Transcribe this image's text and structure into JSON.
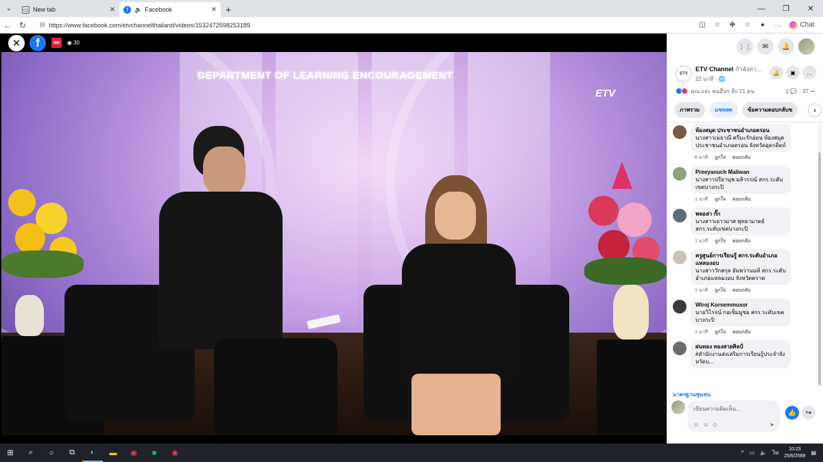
{
  "browser": {
    "tabs": [
      {
        "label": "New tab",
        "icon": "new-tab-icon"
      },
      {
        "label": "Facebook",
        "icon": "facebook-icon",
        "audio": true
      }
    ],
    "url": "https://www.facebook.com/etvchannelthailand/videos/1532472598253189",
    "chat_label": "Chat"
  },
  "video": {
    "live_badge": "สด",
    "viewer_count": "30",
    "banner_text": "DEPARTMENT OF LEARNING ENCOURAGEMENT",
    "channel_logo": "ETV"
  },
  "page": {
    "name": "ETV Channel",
    "status_suffix": "กำลังถ่า...",
    "time": "22 นาที",
    "reactions_text": "คุณ และ คนอื่นๆ อีก 21 คน",
    "comment_count": "1",
    "share_count": "37"
  },
  "comment_tabs": [
    "ภาพรวม",
    "แชทสด",
    "ข้อความตอบกลับข"
  ],
  "comment_actions": {
    "like": "ถูกใจ",
    "reply": "ตอบกลับ"
  },
  "comments": [
    {
      "author": "ห้องสมุด ประชาชนอำเภอตรอน",
      "text": "นางสาวเมธาณี ศรีมะรักอ่อน ห้องสมุดประชาชนอำเภอตรอน จังหวัดอุตรดิตถ์",
      "time": "6 นาที",
      "avatar_color": "#7a5b43"
    },
    {
      "author": "Preeyanuch Maliwan",
      "text": "นางสาวปรียานุช มลิวรรณ์ สกร.ระดับเขตบางกะปิ",
      "time": "1 นาที",
      "avatar_color": "#8fa27c"
    },
    {
      "author": "พลอล่า กั๊ก",
      "text": "นางสาวเยาวมาศ พุทธามาตย์ สกร.ระดับเขตบางกะปิ",
      "time": "1 นาที",
      "avatar_color": "#5d6c78"
    },
    {
      "author": "ครูศูนย์การเรียนรู้ สกร.ระดับอำเภอแหลมงอบ",
      "text": "นางสาววักสกุล อัมพวานนท์ สกร.ระดับอำเภอแหลมงอบ จังหวัดตราด",
      "time": "1 นาที",
      "avatar_color": "#c9c3b8"
    },
    {
      "author": "Wiroj Korsemmusor",
      "text": "นายวิโรจน์ กอเซ็มมูซอ สกร.ระดับเขตบางกะปิ",
      "time": "1 นาที",
      "avatar_color": "#3a3a3a"
    },
    {
      "author": "ฝนทอง ทองสายศิลป์",
      "text": "#สำนักงานส่งเสริมการเรียนรู้ประจำจังหวัดบ...",
      "time": "",
      "avatar_color": "#6c6c6c"
    }
  ],
  "more_link": "มาตรฐานชุมชน",
  "composer_placeholder": "เขียนความคิดเห็น...",
  "taskbar": {
    "time": "10:23",
    "date": "25/6/2569"
  }
}
